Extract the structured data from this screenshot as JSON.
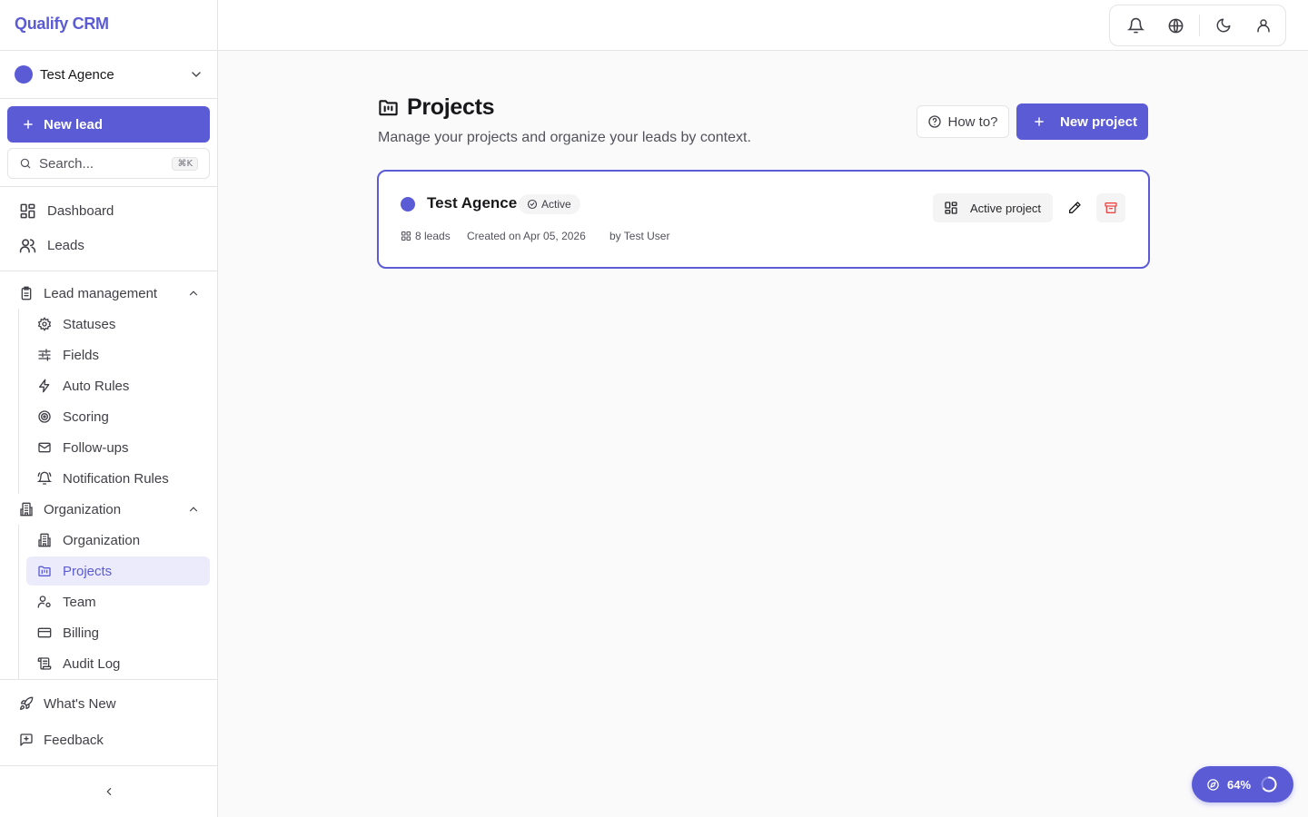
{
  "app": {
    "name": "Qualify CRM"
  },
  "org_switcher": {
    "name": "Test Agence"
  },
  "sidebar": {
    "new_lead_label": "New lead",
    "search_placeholder": "Search...",
    "search_shortcut": "⌘K",
    "main_items": [
      {
        "label": "Dashboard",
        "icon": "dashboard-icon"
      },
      {
        "label": "Leads",
        "icon": "users-icon"
      }
    ],
    "sections": [
      {
        "label": "Lead management",
        "icon": "clipboard-icon",
        "expanded": true,
        "items": [
          {
            "label": "Statuses",
            "icon": "gear-icon"
          },
          {
            "label": "Fields",
            "icon": "sliders-icon"
          },
          {
            "label": "Auto Rules",
            "icon": "bolt-icon"
          },
          {
            "label": "Scoring",
            "icon": "target-icon"
          },
          {
            "label": "Follow-ups",
            "icon": "mail-icon"
          },
          {
            "label": "Notification Rules",
            "icon": "bell-ring-icon"
          }
        ]
      },
      {
        "label": "Organization",
        "icon": "building-icon",
        "expanded": true,
        "items": [
          {
            "label": "Organization",
            "icon": "building-icon"
          },
          {
            "label": "Projects",
            "icon": "folder-kanban-icon",
            "active": true
          },
          {
            "label": "Team",
            "icon": "user-cog-icon"
          },
          {
            "label": "Billing",
            "icon": "credit-card-icon"
          },
          {
            "label": "Audit Log",
            "icon": "scroll-icon"
          }
        ]
      }
    ],
    "footer_items": [
      {
        "label": "What's New",
        "icon": "rocket-icon"
      },
      {
        "label": "Feedback",
        "icon": "message-plus-icon"
      }
    ]
  },
  "topbar": {
    "icons": [
      "bell-icon",
      "globe-icon",
      "moon-icon",
      "user-icon"
    ]
  },
  "page": {
    "title": "Projects",
    "subtitle": "Manage your projects and organize your leads by context.",
    "how_to_label": "How to?",
    "new_project_label": "New project"
  },
  "projects": [
    {
      "name": "Test Agence",
      "status": "Active",
      "leads": "8 leads",
      "created": "Created on Apr 05, 2026",
      "author": "by Test User",
      "active_label": "Active project"
    }
  ],
  "progress": {
    "label": "64%",
    "value": 0.64
  },
  "colors": {
    "accent": "#5b5bd6",
    "danger": "#ef4444",
    "border": "#e4e4e7"
  }
}
